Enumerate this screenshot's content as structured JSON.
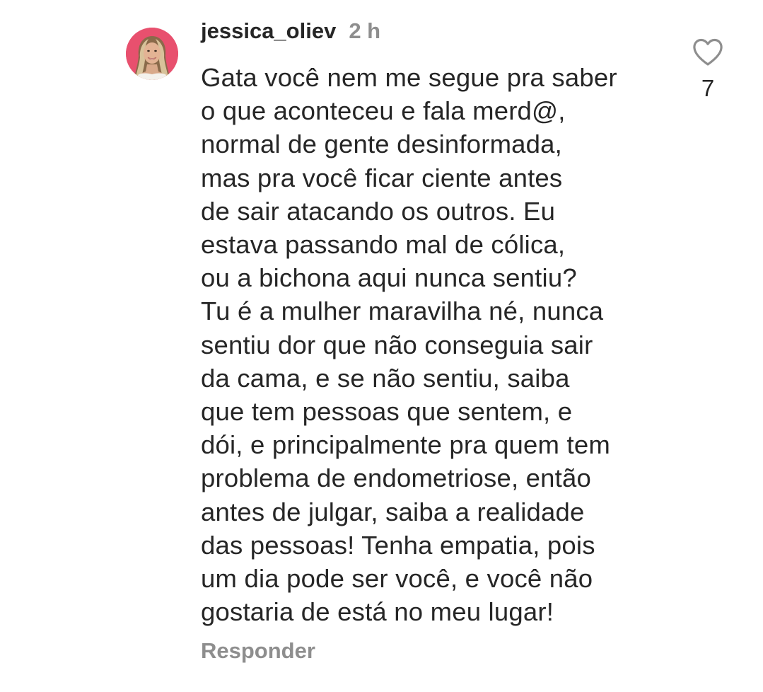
{
  "comment": {
    "username": "jessica_oliev",
    "timestamp": "2 h",
    "avatar": {
      "icon": "profile-photo",
      "background_color": "#e8506e"
    },
    "text_lines": [
      "Gata você nem me segue pra saber",
      "o que aconteceu e fala merd@,",
      "normal de gente desinformada,",
      "mas pra você ficar ciente antes",
      "de sair atacando os outros. Eu",
      "estava passando mal de cólica,",
      "ou a bichona aqui nunca sentiu?",
      "Tu é a mulher maravilha né, nunca",
      "sentiu dor que não conseguia sair",
      "da cama, e se não sentiu, saiba",
      "que tem pessoas que sentem, e",
      "dói, e principalmente pra quem tem",
      "problema de endometriose, então",
      "antes de julgar, saiba a realidade",
      "das pessoas! Tenha empatia, pois",
      "um dia pode ser você, e você não",
      "gostaria de está no meu lugar!"
    ],
    "reply_label": "Responder",
    "like": {
      "icon": "heart-outline-icon",
      "count": "7"
    }
  },
  "colors": {
    "primary_text": "#262626",
    "secondary_text": "#8e8e8e",
    "background": "#ffffff"
  }
}
